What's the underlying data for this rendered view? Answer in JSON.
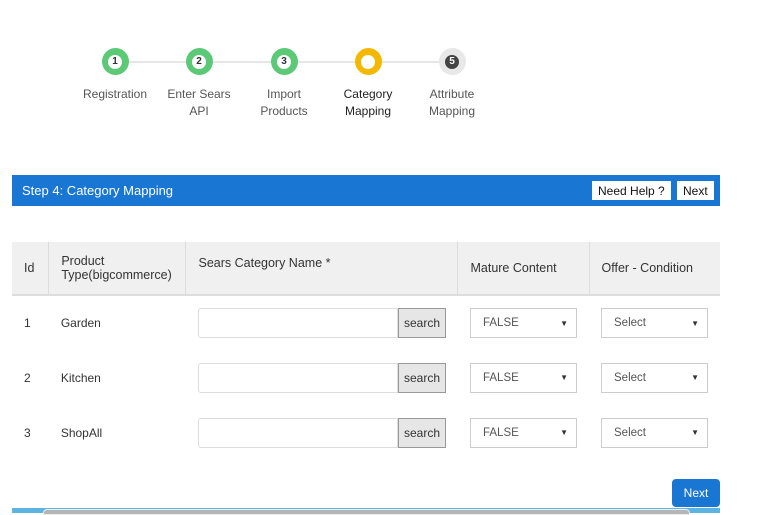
{
  "steps": [
    {
      "num": "1",
      "label1": "Registration",
      "label2": "",
      "state": "done"
    },
    {
      "num": "2",
      "label1": "Enter Sears",
      "label2": "API",
      "state": "done"
    },
    {
      "num": "3",
      "label1": "Import",
      "label2": "Products",
      "state": "done"
    },
    {
      "num": "",
      "label1": "Category",
      "label2": "Mapping",
      "state": "current"
    },
    {
      "num": "5",
      "label1": "Attribute",
      "label2": "Mapping",
      "state": "todo"
    }
  ],
  "header": {
    "title": "Step 4: Category Mapping",
    "help": "Need Help ?",
    "next": "Next"
  },
  "table": {
    "columns": [
      "Id",
      "Product Type(bigcommerce)",
      "Sears Category Name *",
      "Mature Content",
      "Offer - Condition"
    ],
    "rows": [
      {
        "id": "1",
        "type": "Garden",
        "category": "",
        "search": "search",
        "mature": "FALSE",
        "offer": "Select"
      },
      {
        "id": "2",
        "type": "Kitchen",
        "category": "",
        "search": "search",
        "mature": "FALSE",
        "offer": "Select"
      },
      {
        "id": "3",
        "type": "ShopAll",
        "category": "",
        "search": "search",
        "mature": "FALSE",
        "offer": "Select"
      }
    ]
  },
  "footer": {
    "next": "Next"
  }
}
